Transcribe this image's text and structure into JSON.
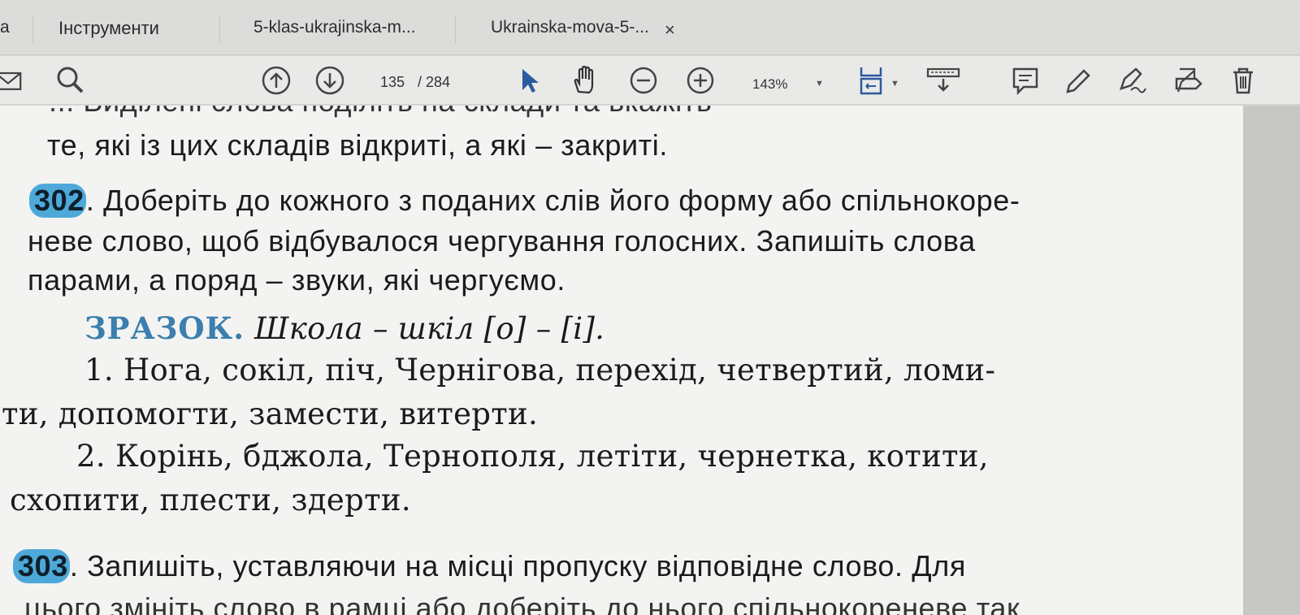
{
  "tabs": {
    "first_label": "а",
    "tools_label": "Інструменти",
    "doc1_label": "5-klas-ukrajinska-m...",
    "doc2_label": "Ukrainska-mova-5-...",
    "close_glyph": "×"
  },
  "toolbar": {
    "page_current": "135",
    "page_total": "/ 284",
    "zoom": "143%",
    "icons": [
      "mail-icon",
      "search-icon",
      "page-up-icon",
      "page-down-icon",
      "select-cursor-icon",
      "hand-icon",
      "zoom-out-icon",
      "zoom-in-icon",
      "fit-page-icon",
      "scroll-mode-icon",
      "comment-icon",
      "pen-icon",
      "sign-icon",
      "stamp-icon",
      "trash-icon"
    ]
  },
  "document": {
    "top_cut_text": "... Виділені слова поділіть на склади та вкажіть",
    "line_prev": "те, які із цих складів відкриті, а які – закриті.",
    "ex302": {
      "number": "302",
      "line1": ". Доберіть до кожного з поданих слів його форму або спільнокоре-",
      "line2": "неве слово, щоб відбувалося чергування голосних. Запишіть слова",
      "line3": "парами, а поряд – звуки, які чергуємо."
    },
    "sample": {
      "head": "ЗРАЗОК.",
      "text": "Школа – шкіл [о] – [і]."
    },
    "list1_line1": "1. Нога, сокіл, піч, Чернігова, перехід, четвертий, ломи-",
    "list1_line2": "ти, допомогти, замести, витерти.",
    "list2_line1": "2. Корінь, бджола, Тернополя, летіти, чернетка, котити,",
    "list2_line2": "схопити, плести, здерти.",
    "ex303": {
      "number": "303",
      "line1": ". Запишіть, уставляючи на місці пропуску відповідне слово. Для",
      "line2_cut": "цього змініть слово в рамці або доберіть до нього спільнокореневе так"
    }
  },
  "colors": {
    "badge": "#4ea9d9",
    "sample_head": "#3a7fae",
    "page_bg": "#f3f3f1",
    "toolbar_bg": "#e9e9e7"
  }
}
